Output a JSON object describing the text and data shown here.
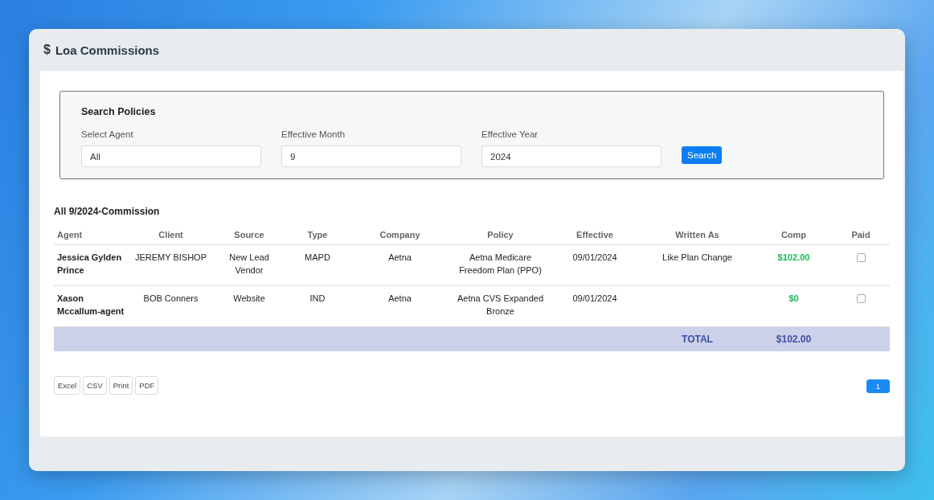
{
  "window": {
    "icon": "$",
    "title": "Loa Commissions"
  },
  "search": {
    "title": "Search Policies",
    "fields": [
      {
        "label": "Select Agent",
        "value": "All"
      },
      {
        "label": "Effective Month",
        "value": "9"
      },
      {
        "label": "Effective Year",
        "value": "2024"
      }
    ],
    "button": "Search"
  },
  "table": {
    "title": "All 9/2024-Commission",
    "columns": [
      "Agent",
      "Client",
      "Source",
      "Type",
      "Company",
      "Policy",
      "Effective",
      "Written As",
      "Comp",
      "Paid"
    ],
    "rows": [
      {
        "agent": "Jessica Gylden Prince",
        "client": "JEREMY BISHOP",
        "source": "New Lead Vendor",
        "type": "MAPD",
        "company": "Aetna",
        "policy": "Aetna Medicare Freedom Plan (PPO)",
        "effective": "09/01/2024",
        "written_as": "Like Plan Change",
        "comp": "$102.00",
        "paid": false
      },
      {
        "agent": "Xason Mccallum-agent",
        "client": "BOB Conners",
        "source": "Website",
        "type": "IND",
        "company": "Aetna",
        "policy": "Aetna CVS Expanded Bronze",
        "effective": "09/01/2024",
        "written_as": "",
        "comp": "$0",
        "paid": false
      }
    ],
    "total": {
      "label": "TOTAL",
      "value": "$102.00"
    }
  },
  "export_buttons": [
    "Excel",
    "CSV",
    "Print",
    "PDF"
  ],
  "pagination": [
    {
      "label": "1",
      "selected": true
    }
  ]
}
